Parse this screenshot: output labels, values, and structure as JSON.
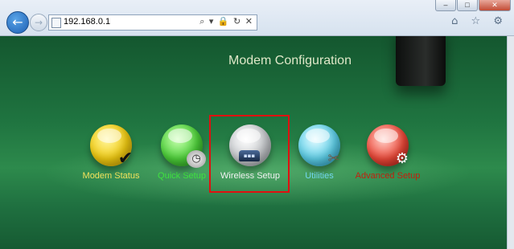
{
  "browser": {
    "address": "192.168.0.1",
    "address_actions": "⌕ ▾ 🔒 ↻ ✕",
    "toolbar_icons": "⌂ ☆ ⚙",
    "window_controls": {
      "minimize": "–",
      "maximize": "□",
      "close": "✕"
    },
    "back": "←",
    "forward": "→"
  },
  "page": {
    "title": "Modem Configuration",
    "menu": [
      {
        "label": "Modem Status",
        "icon": "checkmark-icon",
        "color": "#f2cc12",
        "glyph": "✔"
      },
      {
        "label": "Quick Setup",
        "icon": "clock-icon",
        "color": "#4ed23a",
        "glyph": "◷"
      },
      {
        "label": "Wireless Setup",
        "icon": "router-icon",
        "color": "#c9cccf",
        "glyph": "▪▪▪"
      },
      {
        "label": "Utilities",
        "icon": "tools-icon",
        "color": "#5fd1ea",
        "glyph": "✂"
      },
      {
        "label": "Advanced Setup",
        "icon": "gears-icon",
        "color": "#ee4a3a",
        "glyph": "⚙"
      }
    ],
    "highlighted_item": "Wireless Setup",
    "highlight_color": "#e01010"
  }
}
